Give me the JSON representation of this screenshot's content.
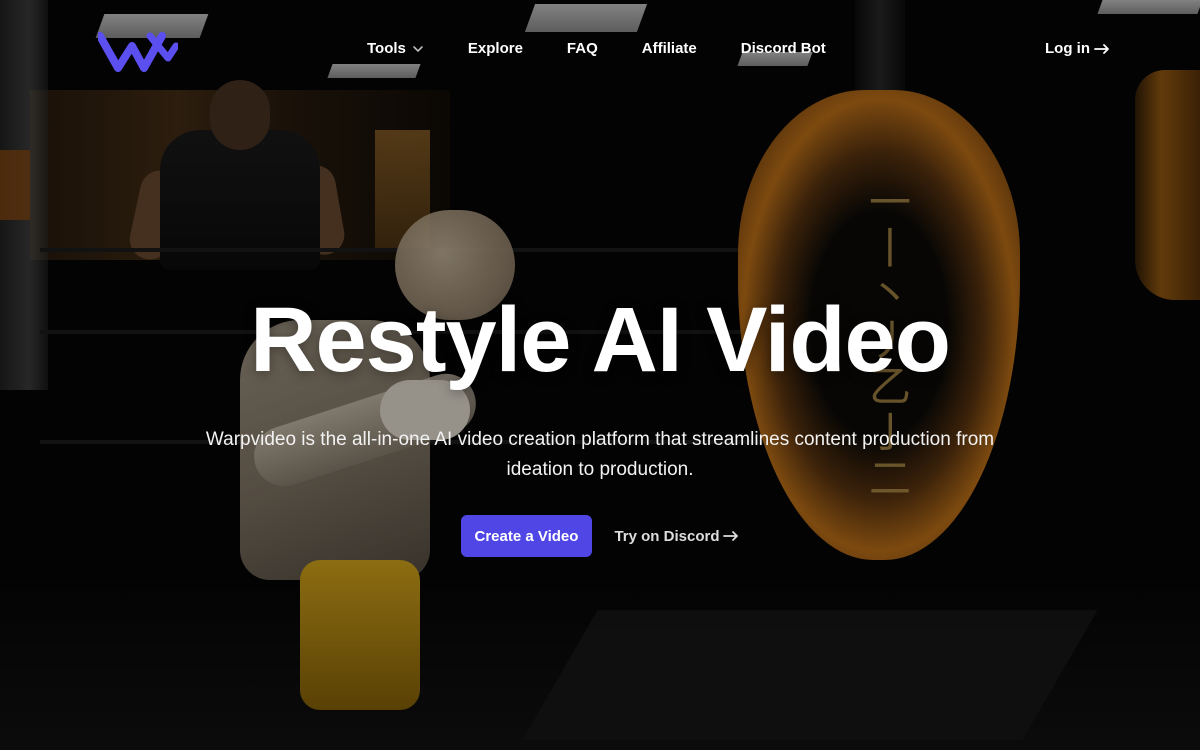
{
  "nav": {
    "logo_alt": "Warpvideo",
    "links": [
      {
        "label": "Tools",
        "has_dropdown": true
      },
      {
        "label": "Explore"
      },
      {
        "label": "FAQ"
      },
      {
        "label": "Affiliate"
      },
      {
        "label": "Discord Bot"
      }
    ],
    "login_label": "Log in"
  },
  "hero": {
    "title": "Restyle AI Video",
    "subtitle": "Warpvideo is the all-in-one AI video creation platform that streamlines content production from ideation to production.",
    "primary_cta": "Create a Video",
    "secondary_cta": "Try on Discord"
  },
  "icons": {
    "logo": "warpvideo-w-logo-icon",
    "dropdown": "chevron-down-icon",
    "arrow": "arrow-right-icon"
  },
  "colors": {
    "accent": "#4f46e5",
    "logo": "#5b4ff0",
    "text": "#ffffff"
  }
}
